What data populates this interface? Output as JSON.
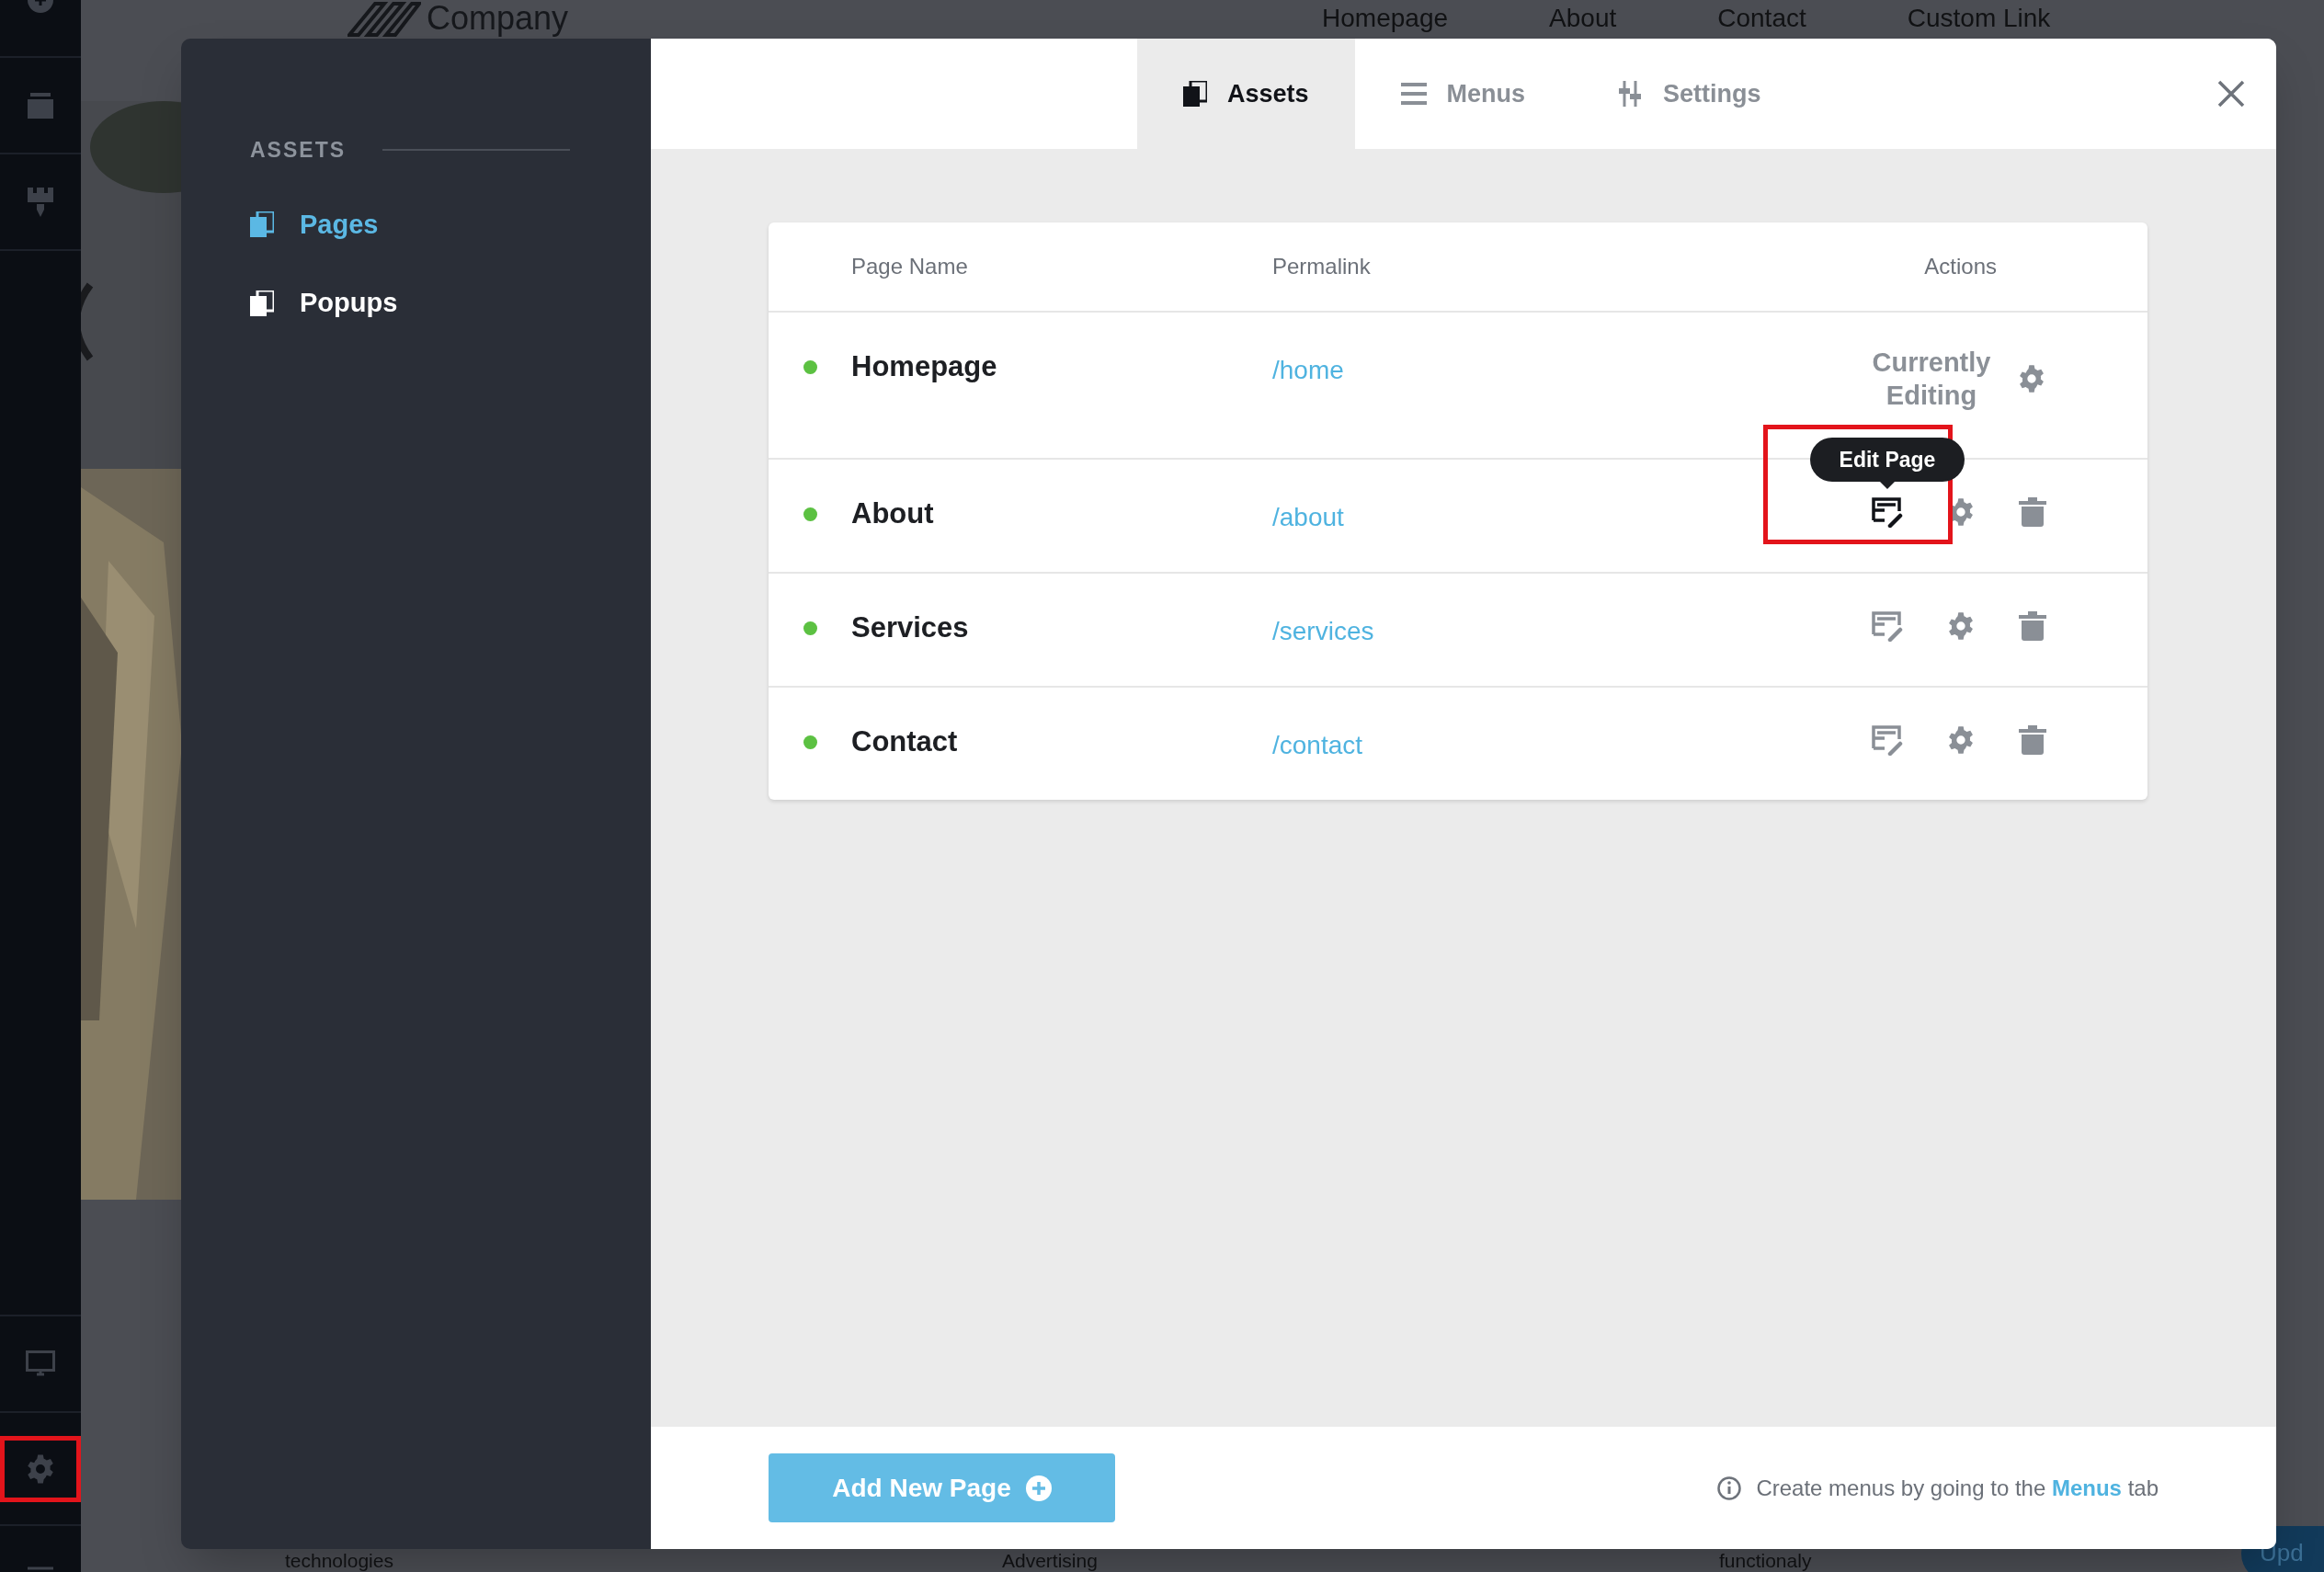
{
  "website": {
    "logo": "Company",
    "nav": [
      "Homepage",
      "About",
      "Contact",
      "Custom Link"
    ],
    "footer_words": [
      "technologies",
      "Advertising",
      "functionaly"
    ],
    "badge": "Upd"
  },
  "sidebar": {
    "title": "ASSETS",
    "items": [
      {
        "label": "Pages",
        "selected": true
      },
      {
        "label": "Popups",
        "selected": false
      }
    ]
  },
  "tabs": [
    {
      "label": "Assets",
      "kind": "page",
      "selected": true
    },
    {
      "label": "Menus",
      "kind": "menu",
      "selected": false
    },
    {
      "label": "Settings",
      "kind": "sliders",
      "selected": false
    }
  ],
  "table": {
    "columns": [
      "Page Name",
      "Permalink",
      "Actions"
    ],
    "rows": [
      {
        "name": "Homepage",
        "permalink": "/home",
        "published": true,
        "current": true,
        "status": "Currently Editing"
      },
      {
        "name": "About",
        "permalink": "/about",
        "published": true,
        "current": false,
        "tooltip": "Edit Page"
      },
      {
        "name": "Services",
        "permalink": "/services",
        "published": true,
        "current": false
      },
      {
        "name": "Contact",
        "permalink": "/contact",
        "published": true,
        "current": false
      }
    ]
  },
  "footer": {
    "button": "Add New Page",
    "hint": "Create menus by going to the",
    "hint_link": "Menus",
    "hint_end": "tab"
  }
}
